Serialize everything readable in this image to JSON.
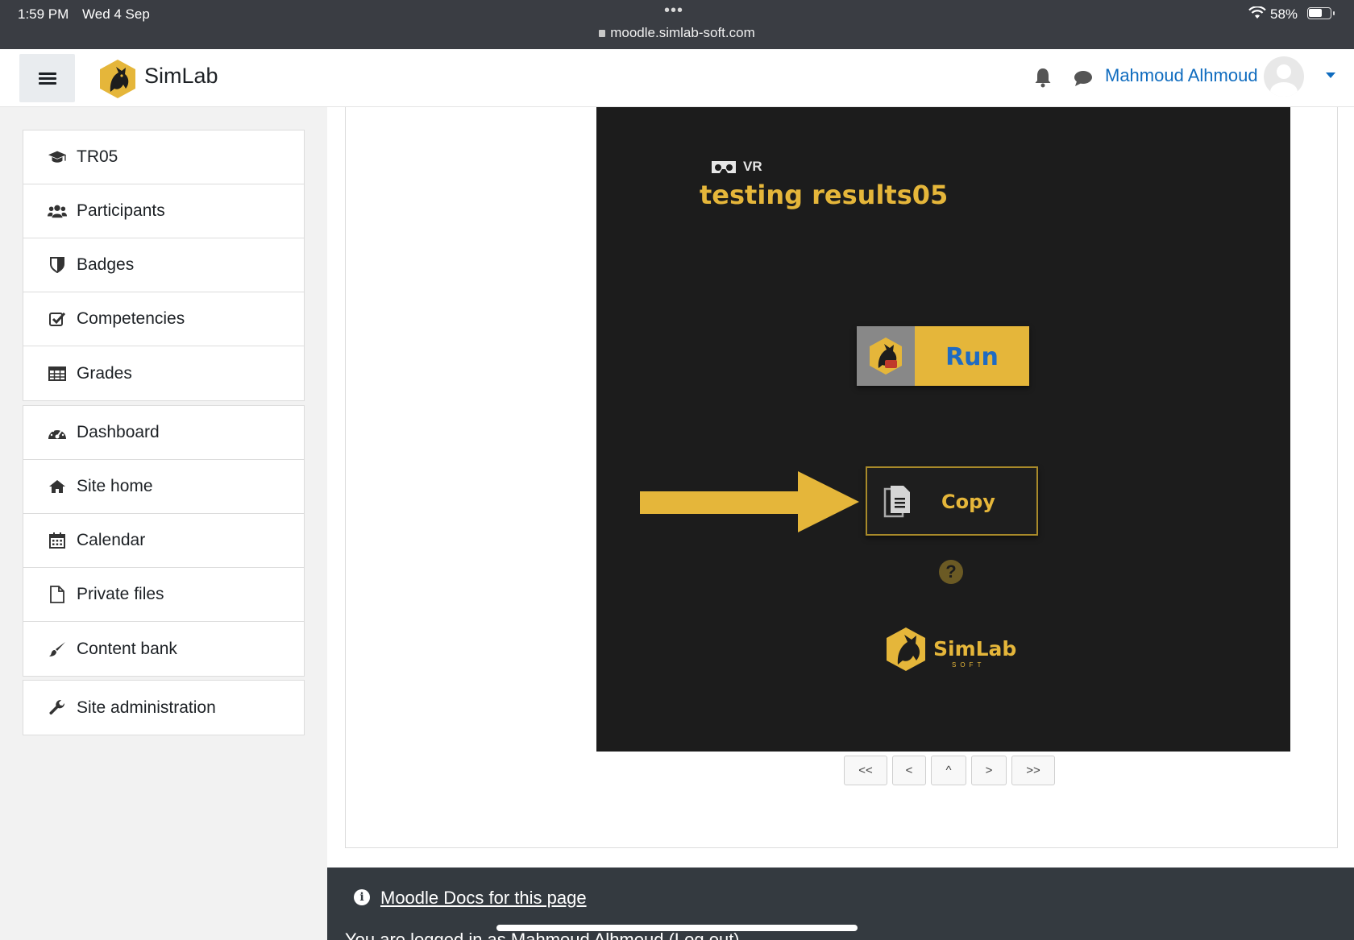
{
  "status_bar": {
    "time": "1:59 PM",
    "date": "Wed 4 Sep",
    "dots": "•••",
    "url": "moodle.simlab-soft.com",
    "battery": "58%"
  },
  "navbar": {
    "brand": "SimLab",
    "user_name": "Mahmoud Alhmoud"
  },
  "drawer": {
    "course_items": [
      {
        "label": "TR05",
        "icon": "graduation-cap-icon"
      },
      {
        "label": "Participants",
        "icon": "users-icon"
      },
      {
        "label": "Badges",
        "icon": "shield-icon"
      },
      {
        "label": "Competencies",
        "icon": "check-square-icon"
      },
      {
        "label": "Grades",
        "icon": "table-icon"
      }
    ],
    "site_items": [
      {
        "label": "Dashboard",
        "icon": "dashboard-icon"
      },
      {
        "label": "Site home",
        "icon": "home-icon"
      },
      {
        "label": "Calendar",
        "icon": "calendar-icon"
      },
      {
        "label": "Private files",
        "icon": "file-icon"
      },
      {
        "label": "Content bank",
        "icon": "paint-brush-icon"
      }
    ],
    "admin_items": [
      {
        "label": "Site administration",
        "icon": "wrench-icon"
      }
    ]
  },
  "viewer": {
    "vr_label": "VR",
    "title": "testing results05",
    "run_label": "Run",
    "copy_label": "Copy",
    "help_symbol": "?",
    "logo_name": "SimLab",
    "logo_sub": "SOFT"
  },
  "pager": {
    "first": "<<",
    "prev": "<",
    "up": "^",
    "next": ">",
    "last": ">>"
  },
  "footer": {
    "docs_link": "Moodle Docs for this page",
    "logged_in_text": "You are logged in as Mahmoud Alhmoud (Log out)"
  },
  "colors": {
    "accent_gold": "#e5b63a",
    "link_blue": "#0f6cbf",
    "viewer_bg": "#1c1c1c",
    "footer_bg": "#343a40"
  }
}
